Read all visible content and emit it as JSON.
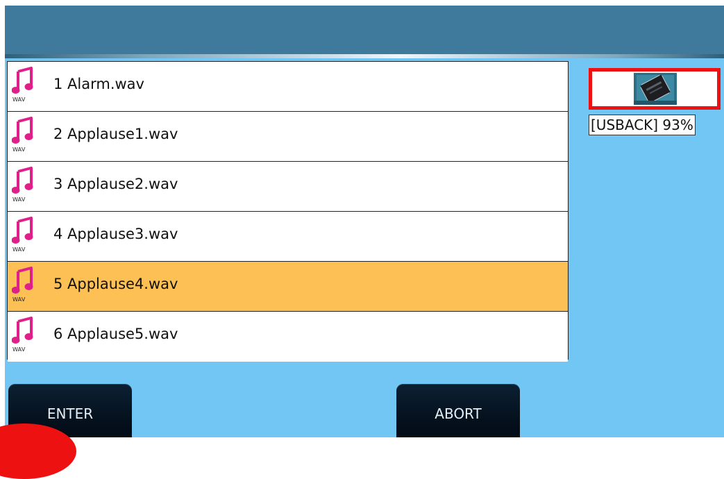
{
  "file_list": {
    "items": [
      {
        "label": "1 Alarm.wav",
        "type_tag": "WAV",
        "selected": false
      },
      {
        "label": "2 Applause1.wav",
        "type_tag": "WAV",
        "selected": false
      },
      {
        "label": "3 Applause2.wav",
        "type_tag": "WAV",
        "selected": false
      },
      {
        "label": "4 Applause3.wav",
        "type_tag": "WAV",
        "selected": false
      },
      {
        "label": "5 Applause4.wav",
        "type_tag": "WAV",
        "selected": true
      },
      {
        "label": "6 Applause5.wav",
        "type_tag": "WAV",
        "selected": false
      }
    ],
    "icon": "music-note-icon"
  },
  "device": {
    "label": "[USBACK] 93%",
    "icon": "usb-chip-icon"
  },
  "buttons": {
    "enter_label": "ENTER",
    "abort_label": "ABORT"
  },
  "colors": {
    "screen_bg": "#71c6f4",
    "header_bg": "#3f7a9c",
    "selected_row": "#fcc054",
    "icon_pink": "#e0208a",
    "device_border": "#ee1111",
    "button_bg": "#04101c"
  }
}
